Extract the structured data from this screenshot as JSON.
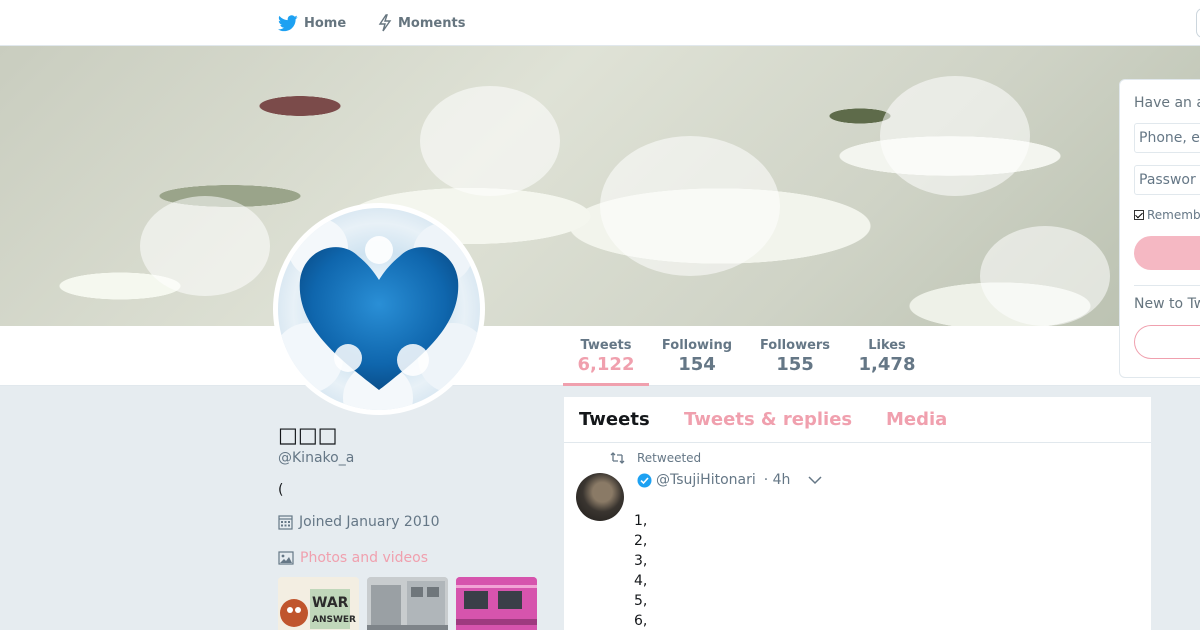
{
  "nav": {
    "home_label": "Home",
    "moments_label": "Moments"
  },
  "profile": {
    "name": "□□□",
    "handle": "@Kinako_a",
    "bio": "(",
    "joined": "Joined January 2010",
    "photos_label": "Photos and videos"
  },
  "stats": [
    {
      "label": "Tweets",
      "value": "6,122",
      "active": true
    },
    {
      "label": "Following",
      "value": "154",
      "active": false
    },
    {
      "label": "Followers",
      "value": "155",
      "active": false
    },
    {
      "label": "Likes",
      "value": "1,478",
      "active": false
    }
  ],
  "timeline": {
    "tabs": [
      {
        "label": "Tweets",
        "active": true
      },
      {
        "label": "Tweets & replies",
        "active": false
      },
      {
        "label": "Media",
        "active": false
      }
    ],
    "tweet": {
      "retweeted_label": "Retweeted",
      "handle": "@TsujiHitonari",
      "time": "· 4h",
      "lines": [
        "1,",
        "2,",
        "3,",
        "4,",
        "5,",
        "6,"
      ]
    }
  },
  "login": {
    "title": "Have an a",
    "phone_placeholder": "Phone, e",
    "password_placeholder": "Passwor",
    "remember": "Rememb",
    "new_prompt": "New to Tw"
  },
  "colors": {
    "accent": "#f0a0ae",
    "twitter_blue": "#1da1f2",
    "muted": "#657786",
    "background": "#e6ecf0"
  }
}
